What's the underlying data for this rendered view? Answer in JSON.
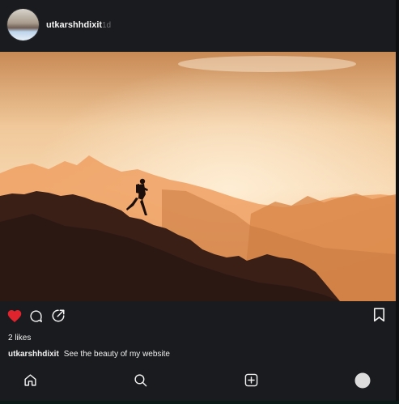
{
  "post": {
    "username": "utkarshhdixit",
    "time": "1d",
    "likes": "2 likes",
    "caption_user": "utkarshhdixit",
    "caption_text": "See the beauty of my website",
    "liked": true
  },
  "icons": {
    "like": "heart-icon",
    "comment": "comment-icon",
    "share": "share-icon",
    "save": "bookmark-icon"
  },
  "nav": [
    {
      "name": "home",
      "icon": "home-icon"
    },
    {
      "name": "search",
      "icon": "search-icon"
    },
    {
      "name": "create",
      "icon": "plus-square-icon"
    },
    {
      "name": "profile",
      "icon": "avatar-icon"
    }
  ],
  "colors": {
    "like": "#e0242e",
    "background": "#1a1b1e"
  }
}
